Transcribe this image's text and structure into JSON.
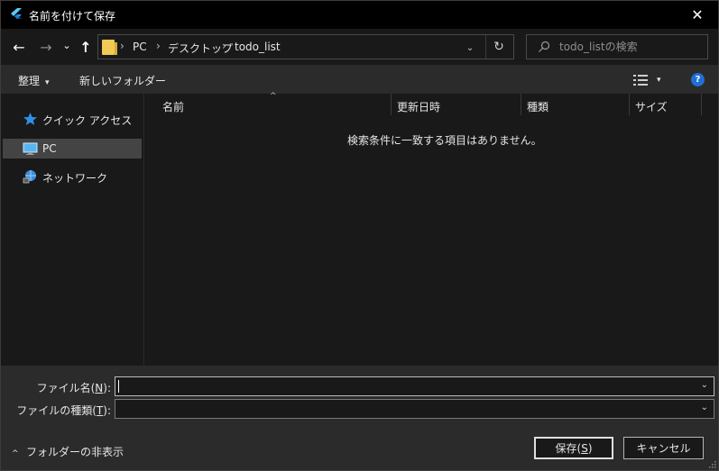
{
  "window": {
    "title": "名前を付けて保存",
    "close_glyph": "✕"
  },
  "nav": {
    "back_glyph": "←",
    "forward_glyph": "→",
    "history_glyph": "⌄",
    "up_glyph": "↑",
    "breadcrumb": [
      "PC",
      "デスクトップ",
      "todo_list"
    ],
    "breadcrumb_sep": "›",
    "refresh_glyph": "↻",
    "dropdown_glyph": "⌄",
    "search_placeholder": "todo_listの検索"
  },
  "toolbar": {
    "organize_label": "整理",
    "new_folder_label": "新しいフォルダー",
    "caret": "▾",
    "help_label": "?"
  },
  "sidebar": {
    "items": [
      {
        "label": "クイック アクセス",
        "icon": "star-icon"
      },
      {
        "label": "PC",
        "icon": "pc-icon",
        "selected": true
      },
      {
        "label": "ネットワーク",
        "icon": "network-icon"
      }
    ]
  },
  "file_list": {
    "columns": [
      "名前",
      "更新日時",
      "種類",
      "サイズ"
    ],
    "sort_glyph": "^",
    "empty_message": "検索条件に一致する項目はありません。"
  },
  "form": {
    "filename_label": "ファイル名(",
    "filename_key": "N",
    "filename_label_end": "):",
    "filename_value": "",
    "filetype_label": "ファイルの種類(",
    "filetype_key": "T",
    "filetype_label_end": "):",
    "filetype_value": "",
    "caret": "⌄"
  },
  "footer": {
    "hide_folders_label": "フォルダーの非表示",
    "hide_glyph": "^",
    "save_label_start": "保存(",
    "save_key": "S",
    "save_label_end": ")",
    "cancel_label": "キャンセル"
  },
  "colors": {
    "accent": "#1f6fd6",
    "folder": "#f2c955",
    "background": "#191919",
    "panel": "#2b2b2b"
  }
}
